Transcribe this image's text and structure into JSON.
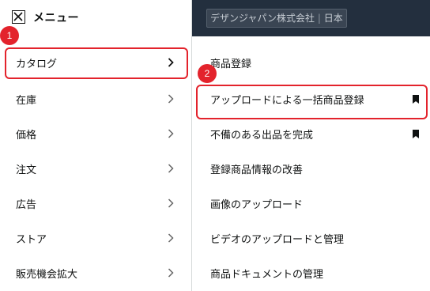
{
  "header": {
    "menu_title": "メニュー"
  },
  "store": {
    "name": "デザンジャパン株式会社",
    "separator": "|",
    "region": "日本"
  },
  "left_menu": [
    {
      "label": "カタログ"
    },
    {
      "label": "在庫"
    },
    {
      "label": "価格"
    },
    {
      "label": "注文"
    },
    {
      "label": "広告"
    },
    {
      "label": "ストア"
    },
    {
      "label": "販売機会拡大"
    }
  ],
  "right_menu": [
    {
      "label": "商品登録",
      "bookmarked": false
    },
    {
      "label": "アップロードによる一括商品登録",
      "bookmarked": true
    },
    {
      "label": "不備のある出品を完成",
      "bookmarked": true
    },
    {
      "label": "登録商品情報の改善",
      "bookmarked": false
    },
    {
      "label": "画像のアップロード",
      "bookmarked": false
    },
    {
      "label": "ビデオのアップロードと管理",
      "bookmarked": false
    },
    {
      "label": "商品ドキュメントの管理",
      "bookmarked": false
    }
  ],
  "annotations": {
    "badge_1": "1",
    "badge_2": "2"
  },
  "colors": {
    "accent_red": "#e3232c",
    "header_dark": "#232f3e"
  }
}
